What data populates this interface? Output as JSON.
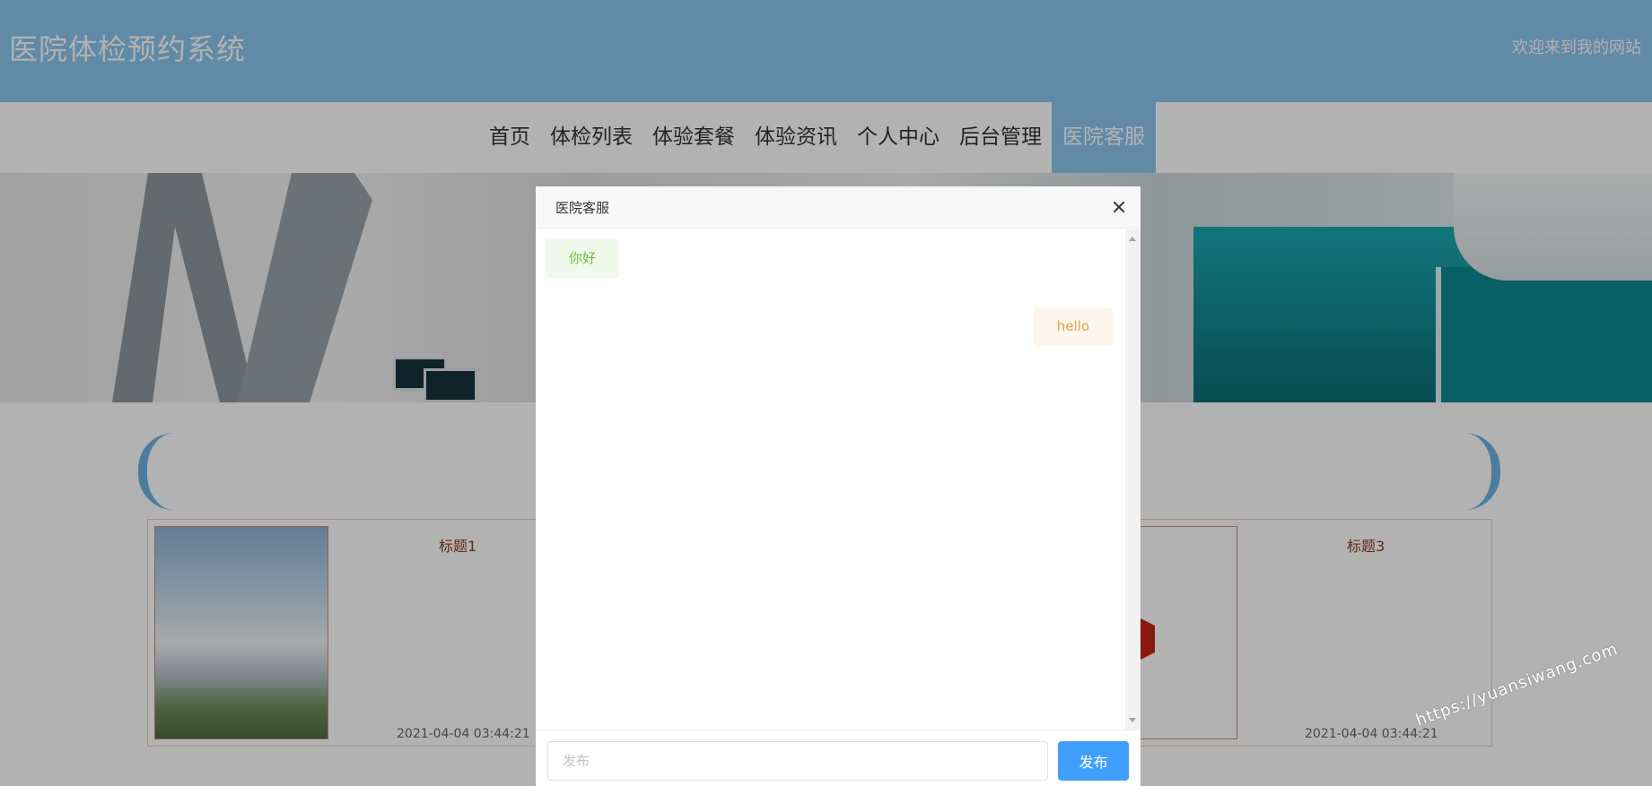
{
  "site": {
    "title": "医院体检预约系统",
    "welcome": "欢迎来到我的网站"
  },
  "nav": {
    "items": [
      {
        "label": "首页",
        "active": false
      },
      {
        "label": "体检列表",
        "active": false
      },
      {
        "label": "体验套餐",
        "active": false
      },
      {
        "label": "体验资讯",
        "active": false
      },
      {
        "label": "个人中心",
        "active": false
      },
      {
        "label": "后台管理",
        "active": false
      },
      {
        "label": "医院客服",
        "active": true
      }
    ]
  },
  "cards": [
    {
      "title": "标题1",
      "time": "2021-04-04 03:44:21"
    },
    {
      "title": "标题3",
      "time": "2021-04-04 03:44:21"
    }
  ],
  "watermark": "https://yuansiwang.com",
  "modal": {
    "title": "医院客服",
    "messages": [
      {
        "side": "left",
        "text": "你好"
      },
      {
        "side": "right",
        "text": "hello"
      }
    ],
    "input": {
      "placeholder": "发布",
      "value": ""
    },
    "send_label": "发布"
  },
  "colors": {
    "header": "#8cc6ef",
    "primary_button": "#409eff",
    "bubble_left_text": "#67c23a",
    "bubble_right_text": "#e6a23c"
  }
}
